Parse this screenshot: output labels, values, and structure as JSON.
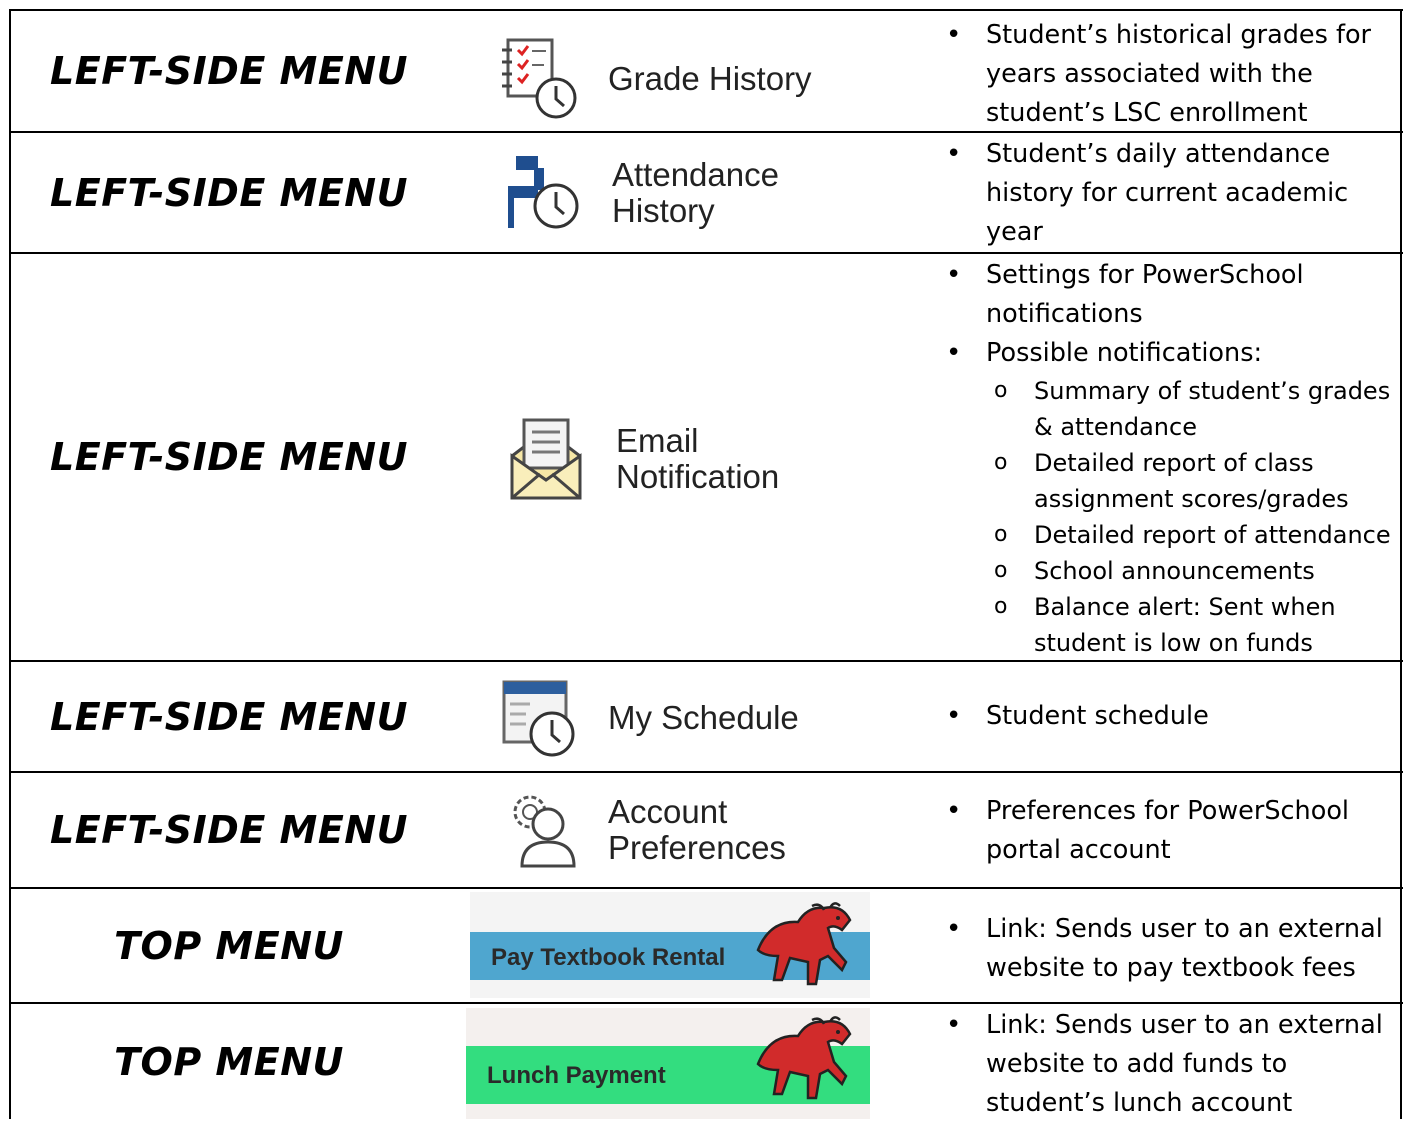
{
  "rows": [
    {
      "location": "LEFT-SIDE MENU",
      "menu_label": "Grade History",
      "icon": "grade-history-icon",
      "bullets": [
        "Student’s historical grades for years associated with the student’s LSC enrollment"
      ]
    },
    {
      "location": "LEFT-SIDE MENU",
      "menu_label_line1": "Attendance",
      "menu_label_line2": "History",
      "icon": "attendance-history-icon",
      "bullets": [
        "Student’s daily attendance history for current academic year"
      ]
    },
    {
      "location": "LEFT-SIDE MENU",
      "menu_label_line1": "Email",
      "menu_label_line2": "Notification",
      "icon": "email-notification-icon",
      "bullets": [
        "Settings for PowerSchool notifications",
        "Possible notifications:"
      ],
      "sub_bullets": [
        "Summary of student’s grades & attendance",
        "Detailed report of class assignment scores/grades",
        "Detailed report of attendance",
        "School announcements",
        "Balance alert: Sent when student is low on funds"
      ]
    },
    {
      "location": "LEFT-SIDE MENU",
      "menu_label": "My Schedule",
      "icon": "my-schedule-icon",
      "bullets": [
        "Student schedule"
      ]
    },
    {
      "location": "LEFT-SIDE MENU",
      "menu_label_line1": "Account",
      "menu_label_line2": "Preferences",
      "icon": "account-preferences-icon",
      "bullets": [
        "Preferences for PowerSchool portal account"
      ]
    },
    {
      "location": "TOP MENU",
      "menu_label": "Pay Textbook Rental",
      "icon": "bronco-mascot-icon",
      "banner_color": "#4fa6cf",
      "bullets": [
        "Link: Sends user to an external website to pay textbook fees"
      ]
    },
    {
      "location": "TOP MENU",
      "menu_label": "Lunch Payment",
      "icon": "bronco-mascot-icon",
      "banner_color": "#33dd7f",
      "bullets": [
        "Link: Sends user to an external website to add funds to student’s lunch account"
      ]
    }
  ]
}
